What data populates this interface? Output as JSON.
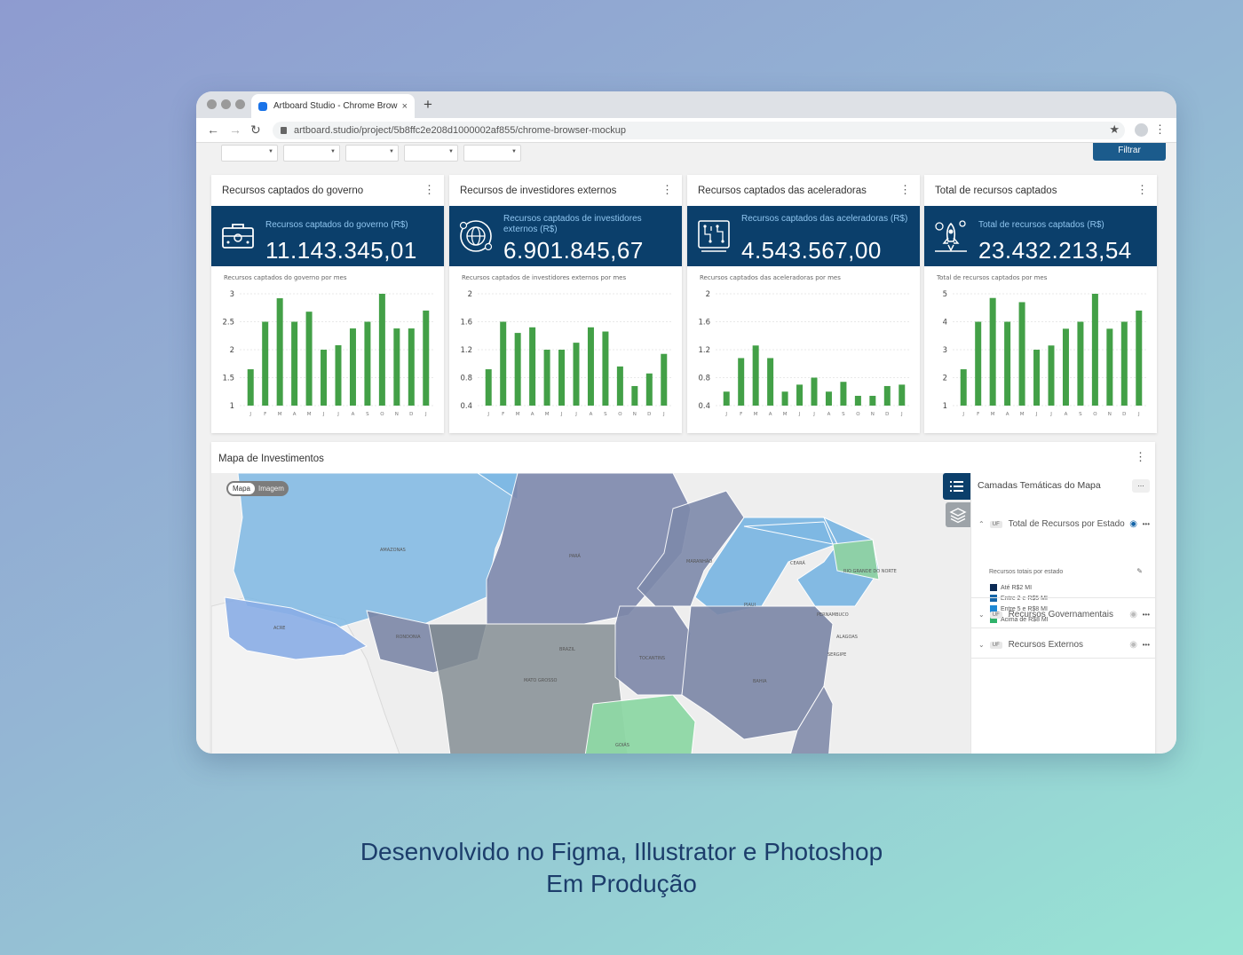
{
  "browser": {
    "tab_title": "Artboard Studio - Chrome Brow",
    "tab_close": "×",
    "new_tab": "+",
    "url": "artboard.studio/project/5b8ffc2e208d1000002af855/chrome-browser-mockup",
    "nav": {
      "back": "←",
      "forward": "→",
      "reload": "↻"
    },
    "star": "★",
    "menu": "⋮"
  },
  "filters": {
    "button_label": "Filtrar"
  },
  "cards": [
    {
      "title": "Recursos captados do governo",
      "kpi_label": "Recursos captados do governo (R$)",
      "kpi_value": "11.143.345,01",
      "icon": "briefcase-icon",
      "chart_title": "Recursos captados do governo por mes"
    },
    {
      "title": "Recursos de investidores externos",
      "kpi_label": "Recursos captados de investidores externos (R$)",
      "kpi_value": "6.901.845,67",
      "icon": "globe-money-icon",
      "chart_title": "Recursos captados de investidores externos por mes"
    },
    {
      "title": "Recursos captados das aceleradoras",
      "kpi_label": "Recursos captados das aceleradoras (R$)",
      "kpi_value": "4.543.567,00",
      "icon": "circuit-board-icon",
      "chart_title": "Recursos captados das aceleradoras por mes"
    },
    {
      "title": "Total de recursos captados",
      "kpi_label": "Total de recursos captados (R$)",
      "kpi_value": "23.432.213,54",
      "icon": "rocket-money-icon",
      "chart_title": "Total de recursos captados por mes"
    }
  ],
  "chart_data": [
    {
      "type": "bar",
      "title": "Recursos captados do governo por mes",
      "categories": [
        "J",
        "F",
        "M",
        "A",
        "M",
        "J",
        "J",
        "A",
        "S",
        "O",
        "N",
        "D",
        "J"
      ],
      "values": [
        1.65,
        2.5,
        2.92,
        2.5,
        2.68,
        2.0,
        2.08,
        2.38,
        2.5,
        3.0,
        2.38,
        2.38,
        2.7
      ],
      "yticks": [
        "3",
        "2.5",
        "2",
        "1.5",
        "1"
      ],
      "ylim": [
        1,
        3
      ],
      "color": "#43a047"
    },
    {
      "type": "bar",
      "title": "Recursos captados de investidores externos por mes",
      "categories": [
        "J",
        "F",
        "M",
        "A",
        "M",
        "J",
        "J",
        "A",
        "S",
        "O",
        "N",
        "D",
        "J"
      ],
      "values": [
        0.92,
        1.6,
        1.44,
        1.52,
        1.2,
        1.2,
        1.3,
        1.52,
        1.46,
        0.96,
        0.68,
        0.86,
        1.14
      ],
      "yticks": [
        "2",
        "1.6",
        "1.2",
        "0.8",
        "0.4"
      ],
      "ylim": [
        0.4,
        2
      ],
      "color": "#43a047"
    },
    {
      "type": "bar",
      "title": "Recursos captados das aceleradoras por mes",
      "categories": [
        "J",
        "F",
        "M",
        "A",
        "M",
        "J",
        "J",
        "A",
        "S",
        "O",
        "N",
        "D",
        "J"
      ],
      "values": [
        0.6,
        1.08,
        1.26,
        1.08,
        0.6,
        0.7,
        0.8,
        0.6,
        0.74,
        0.54,
        0.54,
        0.68,
        0.7
      ],
      "yticks": [
        "2",
        "1.6",
        "1.2",
        "0.8",
        "0.4"
      ],
      "ylim": [
        0.4,
        2
      ],
      "color": "#43a047"
    },
    {
      "type": "bar",
      "title": "Total de recursos captados por mes",
      "categories": [
        "J",
        "F",
        "M",
        "A",
        "M",
        "J",
        "J",
        "A",
        "S",
        "O",
        "N",
        "D",
        "J"
      ],
      "values": [
        2.3,
        4.0,
        4.85,
        4.0,
        4.7,
        3.0,
        3.15,
        3.75,
        4.0,
        5.0,
        3.75,
        4.0,
        4.4
      ],
      "yticks": [
        "5",
        "4",
        "3",
        "2",
        "1"
      ],
      "ylim": [
        1,
        5
      ],
      "color": "#43a047"
    }
  ],
  "map": {
    "title": "Mapa de Investimentos",
    "toggle_on": "Mapa",
    "toggle_off": "Imagem",
    "panel_title": "Camadas Temáticas do Mapa",
    "panel_dots": "...",
    "layers": [
      {
        "uf": "UF",
        "name": "Total de Recursos por Estado",
        "sub": "Recursos totais por estado"
      },
      {
        "uf": "UF",
        "name": "Recursos Governamentais"
      },
      {
        "uf": "UF",
        "name": "Recursos Externos"
      }
    ],
    "legend": [
      {
        "label": "Até R$2 MI",
        "color": "#0b2a55"
      },
      {
        "label": "Entre 2 e R$5 MI",
        "color": "#1565a8"
      },
      {
        "label": "Entre 5 e R$8 MI",
        "color": "#1e88d4"
      },
      {
        "label": "Acima de R$8 MI",
        "color": "#2fb26a"
      }
    ],
    "region_labels": {
      "amazonas": "AMAZONAS",
      "acre": "ACRE",
      "rondonia": "RONDONIA",
      "para": "PARÁ",
      "maranhao": "MARANHÃO",
      "piaui": "PIAUI",
      "ceara": "CEARÁ",
      "rn": "RIO GRANDE DO NORTE",
      "pernambuco": "PERNAMBUCO",
      "alagoas": "ALAGOAS",
      "sergipe": "SERGIPE",
      "bahia": "BAHIA",
      "tocantins": "TOCANTINS",
      "mt": "MATO GROSSO",
      "goias": "GOIÁS",
      "brazil": "BRAZIL"
    }
  },
  "caption": {
    "line1": "Desenvolvido no Figma, Illustrator e Photoshop",
    "line2": "Em Produção"
  }
}
